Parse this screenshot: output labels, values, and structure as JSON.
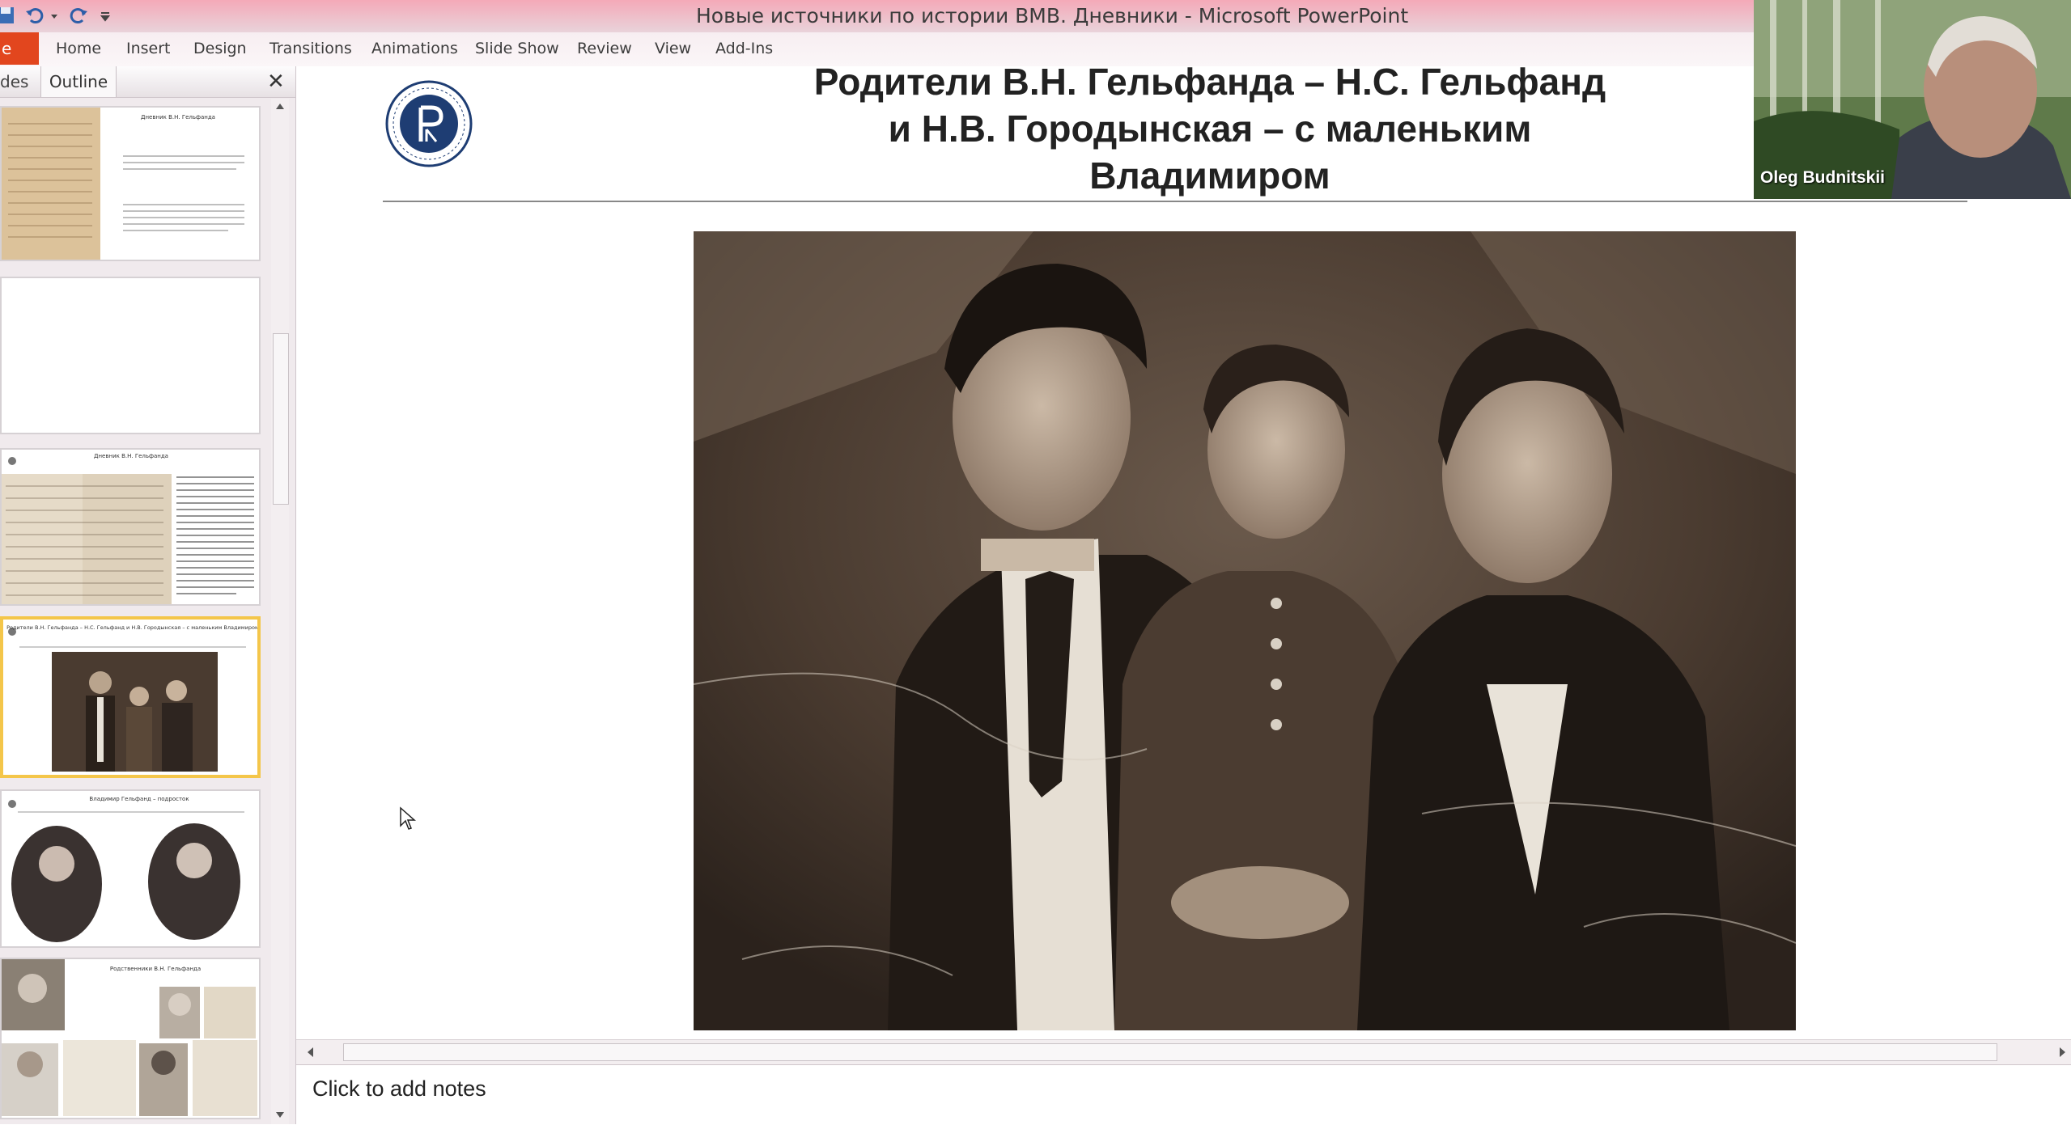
{
  "window": {
    "title": "Новые источники по истории ВМВ. Дневники  -  Microsoft PowerPoint"
  },
  "ribbon": {
    "file_tab": "e",
    "tabs": [
      "Home",
      "Insert",
      "Design",
      "Transitions",
      "Animations",
      "Slide Show",
      "Review",
      "View",
      "Add-Ins"
    ]
  },
  "left_pane": {
    "tabs": {
      "slides": "des",
      "outline": "Outline"
    },
    "close": "✕",
    "thumbnails": [
      {
        "title": "Дневник В.Н. Гельфанда"
      },
      {
        "title": ""
      },
      {
        "title": "Дневник В.Н. Гельфанда"
      },
      {
        "title": "Родители В.Н. Гельфанда – Н.С. Гельфанд и Н.В. Городынская – с маленьким Владимиром"
      },
      {
        "title": "Владимир Гельфанд – подросток"
      },
      {
        "title": "Родственники В.Н. Гельфанда"
      }
    ]
  },
  "slide": {
    "title_lines": [
      "Родители В.Н. Гельфанда – Н.С. Гельфанд",
      "и Н.В. Городынская – с маленьким",
      "Владимиром"
    ]
  },
  "notes": {
    "placeholder": "Click to add notes"
  },
  "webcam": {
    "name": "Oleg Budnitskii"
  },
  "colors": {
    "file_tab": "#e2461e",
    "titlebar": "#f4a9b8",
    "selected_border": "#f4c64a"
  }
}
